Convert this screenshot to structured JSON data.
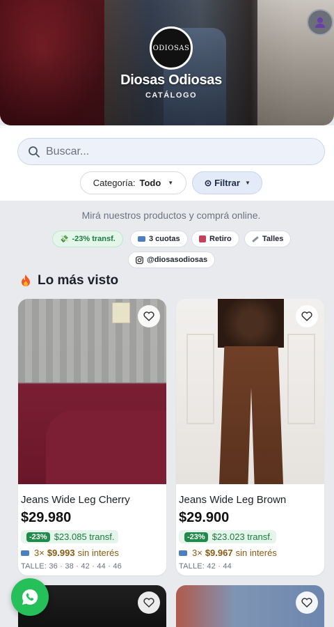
{
  "header": {
    "brand_name": "Diosas Odiosas",
    "subtitle": "CATÁLOGO",
    "logo_text": "ODIOSAS"
  },
  "search": {
    "placeholder": "Buscar..."
  },
  "filters": {
    "category_label": "Categoría:",
    "category_value": "Todo",
    "filter_label": "Filtrar"
  },
  "info": {
    "tagline": "Mirá nuestros productos y comprá online.",
    "chips": {
      "transfer": "-23% transf.",
      "cuotas": "3 cuotas",
      "retiro": "Retiro",
      "talles": "Talles",
      "instagram": "@diosasodiosas"
    }
  },
  "section": {
    "title": "Lo más visto"
  },
  "products": [
    {
      "name": "Jeans Wide Leg Cherry",
      "price": "$29.980",
      "discount_pct": "-23%",
      "transfer_price": "$23.085 transf.",
      "cuotas_prefix": "3×",
      "cuotas_value": "$9.993",
      "cuotas_suffix": "sin interés",
      "sizes": "TALLE: 36 · 38 · 42 · 44 · 46"
    },
    {
      "name": "Jeans Wide Leg Brown",
      "price": "$29.900",
      "discount_pct": "-23%",
      "transfer_price": "$23.023 transf.",
      "cuotas_prefix": "3×",
      "cuotas_value": "$9.967",
      "cuotas_suffix": "sin interés",
      "sizes": "TALLE: 42 · 44"
    }
  ],
  "colors": {
    "accent_green": "#1f8a4a",
    "whatsapp": "#25c05a",
    "search_bg": "#edf2fa"
  }
}
